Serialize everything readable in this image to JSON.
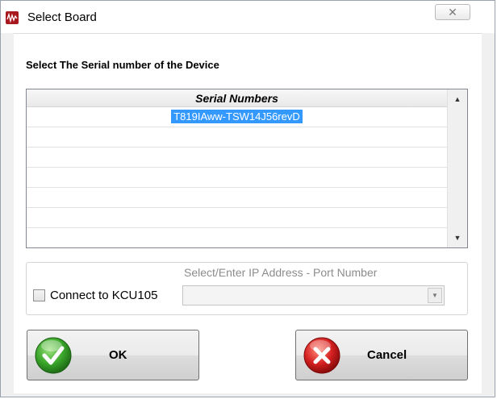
{
  "window": {
    "title": "Select Board"
  },
  "instruction": "Select The Serial number of the Device",
  "serial_grid": {
    "column_header": "Serial Numbers",
    "rows": [
      "T819IAww-TSW14J56revD",
      "",
      "",
      "",
      "",
      ""
    ],
    "selected_row": 0
  },
  "connection": {
    "ip_label": "Select/Enter IP Address - Port Number",
    "checkbox_label": "Connect to KCU105",
    "checkbox_checked": false,
    "ip_value": ""
  },
  "buttons": {
    "ok_label": "OK",
    "cancel_label": "Cancel"
  },
  "colors": {
    "selection": "#3399ff",
    "ok_icon": "#3aa52a",
    "cancel_icon": "#d42020",
    "app_icon": "#a8191f"
  },
  "icons": {
    "app": "app-waveform-icon",
    "close": "close-icon",
    "ok": "check-icon",
    "cancel": "cross-icon"
  }
}
